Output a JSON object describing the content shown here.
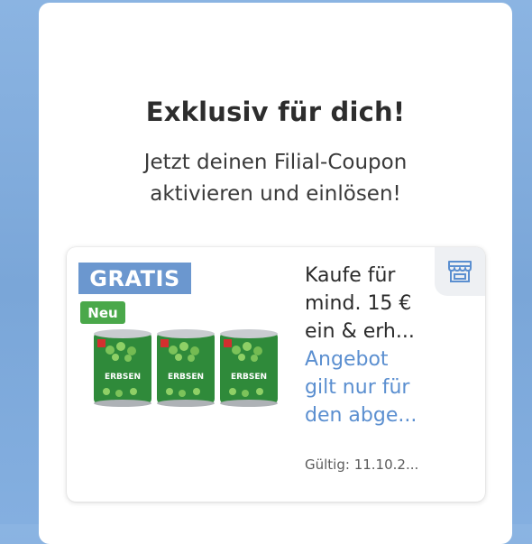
{
  "header": {
    "title": "Exklusiv für dich!",
    "subtitle_line1": "Jetzt deinen Filial-Coupon",
    "subtitle_line2": "aktivieren und einlösen!"
  },
  "coupon": {
    "badge": "GRATIS",
    "new_badge": "Neu",
    "product_label": "ERBSEN",
    "description_lines": [
      "Kaufe für",
      "mind. 15 €",
      "ein & erh..."
    ],
    "condition_lines": [
      "Angebot",
      "gilt nur für",
      "den abge..."
    ],
    "validity": "Gültig: 11.10.2...",
    "store_icon": "store-icon"
  },
  "colors": {
    "badge_blue": "#6b97cf",
    "new_green": "#4aa84a",
    "link_blue": "#5b8fd0",
    "background_blue": "#7aa6d8"
  }
}
